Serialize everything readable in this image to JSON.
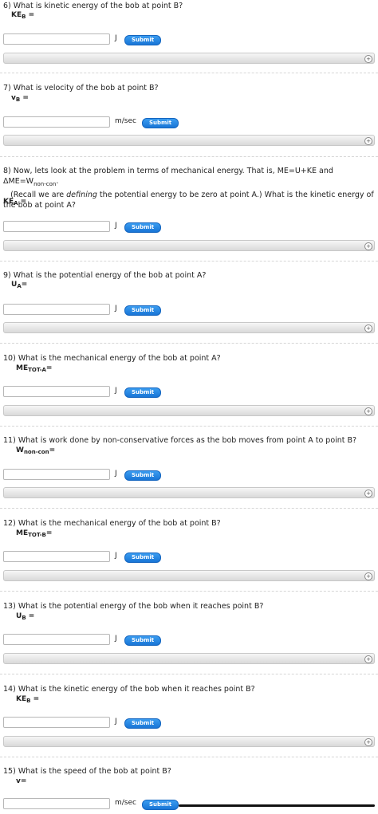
{
  "questions": [
    {
      "text": "6) What is kinetic energy of the bob at point B?",
      "var_base": "KE",
      "var_sub": "B",
      "var_tail": " =",
      "unit": "J",
      "button": "Submit",
      "plus": "+"
    },
    {
      "text": "7) What is velocity of the bob at point B?",
      "var_base": "v",
      "var_sub": "B",
      "var_tail": " =",
      "unit": "m/sec",
      "button": "Submit",
      "plus": "+"
    },
    {
      "text_1": "8) Now, lets look at the problem in terms of mechanical energy. That is, ME=U+KE and ΔME=W",
      "text_sub": "non-con",
      "text_2": ".",
      "text_3": "(Recall we are ",
      "text_em": "defining",
      "text_4": " the potential energy to be zero at point A.) What is the kinetic energy of the bob at point A?",
      "var_base": "KE",
      "var_sub": "A",
      "var_tail": " =",
      "unit": "J",
      "button": "Submit",
      "plus": "+"
    },
    {
      "text": "9) What is the potential energy of the bob at point A?",
      "var_base": "U",
      "var_sub": "A",
      "var_tail": "=",
      "unit": "J",
      "button": "Submit",
      "plus": "+"
    },
    {
      "text": "10) What is the mechanical energy of the bob at point A?",
      "var_base": "ME",
      "var_sub": "TOT-A",
      "var_tail": "=",
      "unit": "J",
      "button": "Submit",
      "plus": "+"
    },
    {
      "text": "11) What is work done by non-conservative forces as the bob moves from point A to point B?",
      "var_base": "W",
      "var_sub": "non-con",
      "var_tail": "=",
      "unit": "J",
      "button": "Submit",
      "plus": "+"
    },
    {
      "text": "12) What is the mechanical energy of the bob at point B?",
      "var_base": "ME",
      "var_sub": "TOT-B",
      "var_tail": "=",
      "unit": "J",
      "button": "Submit",
      "plus": "+"
    },
    {
      "text": "13) What is the potential energy of the bob when it reaches point B?",
      "var_base": "U",
      "var_sub": "B",
      "var_tail": " =",
      "unit": "J",
      "button": "Submit",
      "plus": "+"
    },
    {
      "text": "14) What is the kinetic energy of the bob when it reaches point B?",
      "var_base": "KE",
      "var_sub": "B",
      "var_tail": " =",
      "unit": "J",
      "button": "Submit",
      "plus": "+"
    },
    {
      "text": "15) What is the speed of the bob at point B?",
      "var_base": "v",
      "var_sub": "",
      "var_tail": "=",
      "unit": "m/sec",
      "button": "Submit"
    }
  ],
  "colors": {
    "button": "#1e7fe0",
    "bar": "#e0e0e0"
  }
}
